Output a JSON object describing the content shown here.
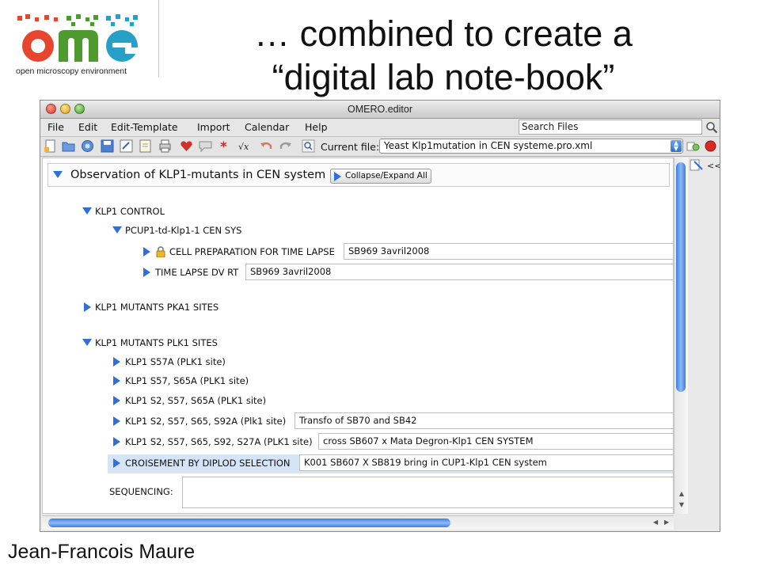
{
  "slide": {
    "logo_caption": "open microscopy environment",
    "title_line1": "… combined to create a",
    "title_line2": "“digital lab note-book”",
    "author": "Jean-Francois Maure"
  },
  "window": {
    "title": "OMERO.editor"
  },
  "menu": {
    "items": [
      "File",
      "Edit",
      "Edit-Template",
      "Import",
      "Calendar",
      "Help"
    ],
    "search_placeholder": "Search Files"
  },
  "toolbar": {
    "icons": [
      "new-file-icon",
      "open-folder-icon",
      "open-server-icon",
      "save-icon",
      "save-as-icon",
      "edit-icon",
      "print-icon",
      "heart-icon",
      "comment-icon",
      "required-star-icon",
      "formula-icon",
      "undo-icon",
      "redo-icon",
      "find-icon"
    ],
    "current_file_label": "Current file:",
    "current_file": "Yeast Klp1mutation in CEN systeme.pro.xml"
  },
  "tree": {
    "root_label": "Observation of KLP1-mutants in CEN system",
    "collapse_expand_label": "Collapse/Expand All",
    "control": "KLP1 CONTROL",
    "pcup": "PCUP1-td-Klp1-1 CEN SYS",
    "cell_prep": {
      "label": "CELL PREPARATION FOR TIME LAPSE",
      "value": "SB969 3avril2008"
    },
    "time_lapse": {
      "label": "TIME LAPSE DV RT",
      "value": "SB969 3avril2008"
    },
    "pka1": "KLP1 MUTANTS PKA1 SITES",
    "plk1": "KLP1 MUTANTS PLK1 SITES",
    "s57a": "KLP1 S57A (PLK1 site)",
    "s57_s65a": "KLP1 S57, S65A (PLK1 site)",
    "s2_s57_s65a": "KLP1 S2, S57, S65A (PLK1 site)",
    "s92a": {
      "label": "KLP1 S2, S57, S65, S92A (Plk1 site)",
      "value": "Transfo of SB70 and SB42"
    },
    "s27a": {
      "label": "KLP1 S2, S57, S65, S92, S27A (PLK1 site)",
      "value": "cross SB607 x Mata Degron-Klp1 CEN SYSTEM"
    },
    "croisement": {
      "label": "CROISEMENT BY DIPLOD SELECTION",
      "value": "K001 SB607 X SB819 bring in CUP1-Klp1 CEN system"
    },
    "sequencing_label": "SEQUENCING:"
  },
  "side_panel": {
    "toggle_label": "<<"
  },
  "colors": {
    "accent_blue": "#2f6fd6",
    "highlight_row": "#d6e4f7"
  }
}
